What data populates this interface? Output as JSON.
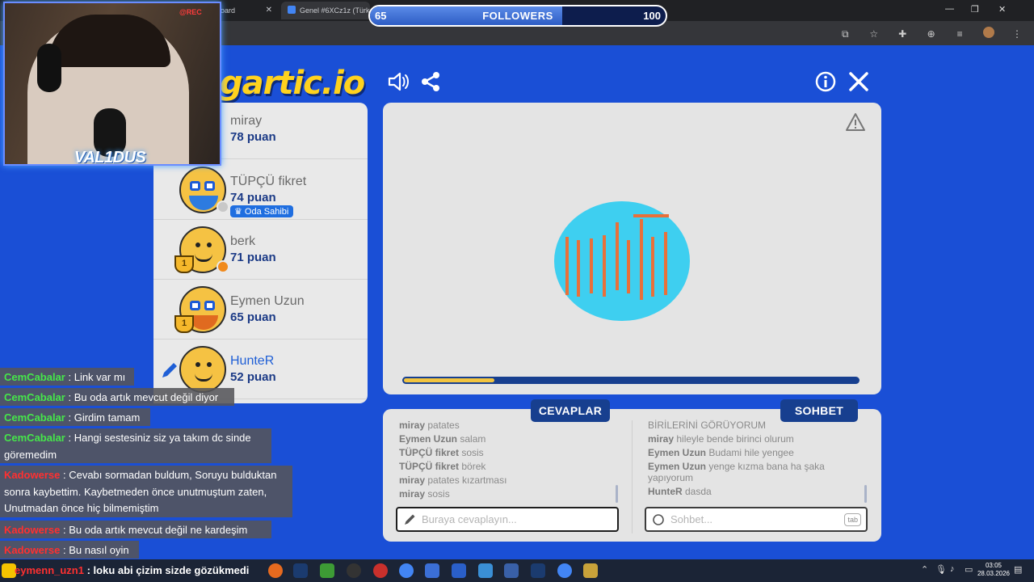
{
  "browser": {
    "tabs": [
      {
        "label": "oard"
      },
      {
        "label": "Genel #6XCz1z (Türkçe) - G"
      }
    ]
  },
  "followers_bar": {
    "current": "65",
    "label": "FOLLOWERS",
    "goal": "100",
    "progress": 0.65
  },
  "webcam": {
    "rec": "@REC",
    "brand": "VAL1DUS"
  },
  "game": {
    "logo": "gartic.io",
    "players": [
      {
        "name": "miray",
        "score": "78 puan"
      },
      {
        "name": "TÜPÇÜ fikret",
        "score": "74 puan",
        "badge": "Oda Sahibi"
      },
      {
        "name": "berk",
        "score": "71 puan",
        "trophy": "1"
      },
      {
        "name": "Eymen Uzun",
        "score": "65 puan",
        "trophy": "1"
      },
      {
        "name": "HunteR",
        "score": "52 puan"
      }
    ],
    "timer_progress": 0.2,
    "tab_answers": "CEVAPLAR",
    "tab_chat": "SOHBET",
    "answers": [
      {
        "user": "miray",
        "text": "patates"
      },
      {
        "user": "Eymen Uzun",
        "text": "salam"
      },
      {
        "user": "TÜPÇÜ fikret",
        "text": "sosis"
      },
      {
        "user": "TÜPÇÜ fikret",
        "text": "börek"
      },
      {
        "user": "miray",
        "text": "patates kızartması"
      },
      {
        "user": "miray",
        "text": "sosis"
      }
    ],
    "chat": [
      {
        "user": "",
        "text": "BİRİLERİNİ GÖRÜYORUM"
      },
      {
        "user": "miray",
        "text": "hileyle bende birinci olurum"
      },
      {
        "user": "Eymen Uzun",
        "text": "Budami hile yengee"
      },
      {
        "user": "Eymen Uzun",
        "text": "yenge kızma bana ha şaka yapıyorum"
      },
      {
        "user": "HunteR",
        "text": "dasda"
      }
    ],
    "answer_placeholder": "Buraya cevaplayın...",
    "chat_placeholder": "Sohbet...",
    "tab_key": "tab"
  },
  "stream_chat": [
    {
      "user": "CemCabalar",
      "color": "#46e64a",
      "text": "Link var mı"
    },
    {
      "user": "CemCabalar",
      "color": "#46e64a",
      "text": "Bu oda artık mevcut değil diyor"
    },
    {
      "user": "CemCabalar",
      "color": "#46e64a",
      "text": "Girdim tamam"
    },
    {
      "user": "CemCabalar",
      "color": "#46e64a",
      "text": "Hangi sestesiniz siz ya takım dc sinde göremedim"
    },
    {
      "user": "Kadowerse",
      "color": "#ff3030",
      "text": "Cevabı sormadan buldum, Soruyu bulduktan sonra kaybettim. Kaybetmeden önce unutmuştum zaten, Unutmadan önce hiç bilmemiştim"
    },
    {
      "user": "Kadowerse",
      "color": "#ff3030",
      "text": "Bu oda artık mevcut değil ne kardeşim"
    },
    {
      "user": "Kadowerse",
      "color": "#ff3030",
      "text": "Bu nasıl oyin"
    },
    {
      "user": "eymenn_uzn1",
      "color": "#e0e0e0",
      "text": "loku abi çizim sizde gözükmedi"
    }
  ],
  "taskbar": {
    "time": "03:05",
    "date": "28.03.2026"
  }
}
